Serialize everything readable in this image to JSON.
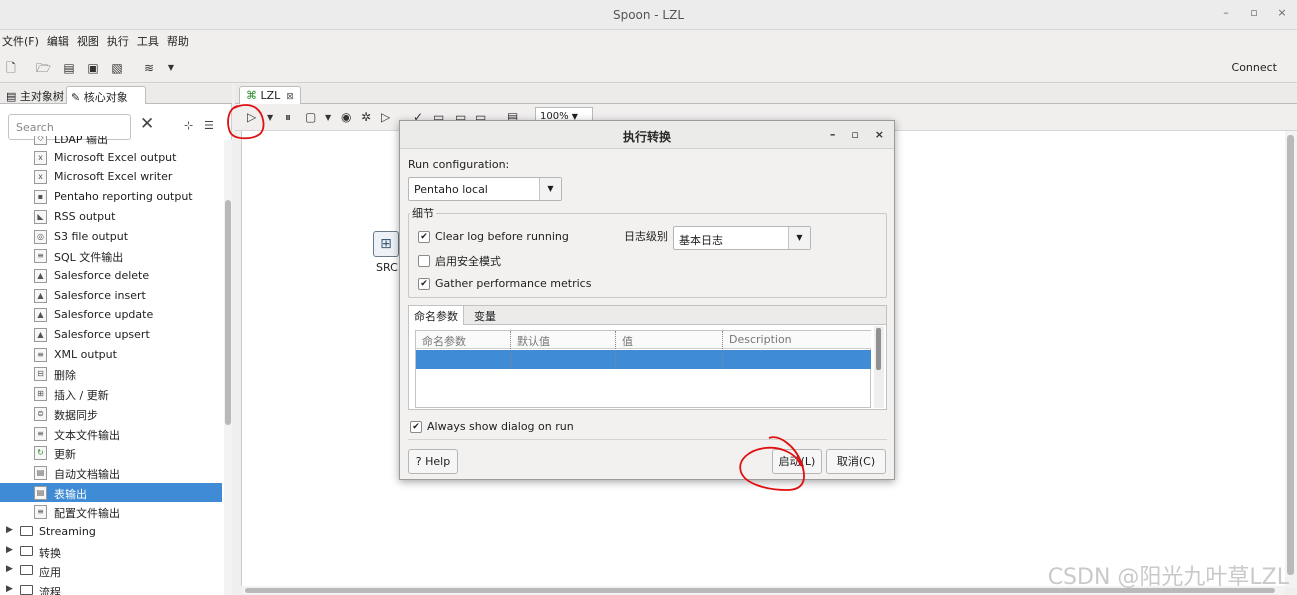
{
  "window": {
    "title": "Spoon - LZL",
    "controls": [
      "–",
      "▫",
      "×"
    ]
  },
  "menu": [
    "文件(F)",
    "编辑",
    "视图",
    "执行",
    "工具",
    "帮助"
  ],
  "toolbar": {
    "connect_label": "Connect"
  },
  "left_panel": {
    "tabs": [
      "主对象树",
      "核心对象"
    ],
    "search_placeholder": "Search",
    "items": [
      {
        "label": "LDAP 输出",
        "icon": "ldap-output-icon"
      },
      {
        "label": "Microsoft Excel output",
        "icon": "excel-output-icon"
      },
      {
        "label": "Microsoft Excel writer",
        "icon": "excel-writer-icon"
      },
      {
        "label": "Pentaho reporting output",
        "icon": "report-output-icon"
      },
      {
        "label": "RSS output",
        "icon": "rss-output-icon"
      },
      {
        "label": "S3 file output",
        "icon": "s3-output-icon"
      },
      {
        "label": "SQL 文件输出",
        "icon": "sql-file-output-icon"
      },
      {
        "label": "Salesforce delete",
        "icon": "salesforce-delete-icon"
      },
      {
        "label": "Salesforce insert",
        "icon": "salesforce-insert-icon"
      },
      {
        "label": "Salesforce update",
        "icon": "salesforce-update-icon"
      },
      {
        "label": "Salesforce upsert",
        "icon": "salesforce-upsert-icon"
      },
      {
        "label": "XML output",
        "icon": "xml-output-icon"
      },
      {
        "label": "删除",
        "icon": "delete-icon"
      },
      {
        "label": "插入 / 更新",
        "icon": "insert-update-icon"
      },
      {
        "label": "数据同步",
        "icon": "data-sync-icon"
      },
      {
        "label": "文本文件输出",
        "icon": "text-file-output-icon"
      },
      {
        "label": "更新",
        "icon": "update-icon"
      },
      {
        "label": "自动文档输出",
        "icon": "auto-doc-output-icon"
      },
      {
        "label": "表输出",
        "icon": "table-output-icon",
        "selected": true
      },
      {
        "label": "配置文件输出",
        "icon": "config-file-output-icon"
      }
    ],
    "folders": [
      "Streaming",
      "转换",
      "应用",
      "流程"
    ]
  },
  "editor": {
    "tab_label": "LZL",
    "zoom": "100%",
    "step_label": "SRC"
  },
  "dialog": {
    "title": "执行转换",
    "run_config_label": "Run configuration:",
    "run_config_value": "Pentaho local",
    "details_group": "细节",
    "clear_log": "Clear log before running",
    "safe_mode": "启用安全模式",
    "gather_metrics": "Gather performance metrics",
    "log_level_label": "日志级别",
    "log_level_value": "基本日志",
    "tabs": [
      "命名参数",
      "变量"
    ],
    "columns": [
      "命名参数",
      "默认值",
      "值",
      "Description"
    ],
    "always_show": "Always show dialog on run",
    "help_label": "Help",
    "start_label": "启动(L)",
    "cancel_label": "取消(C)"
  },
  "watermark": "CSDN @阳光九叶草LZL"
}
